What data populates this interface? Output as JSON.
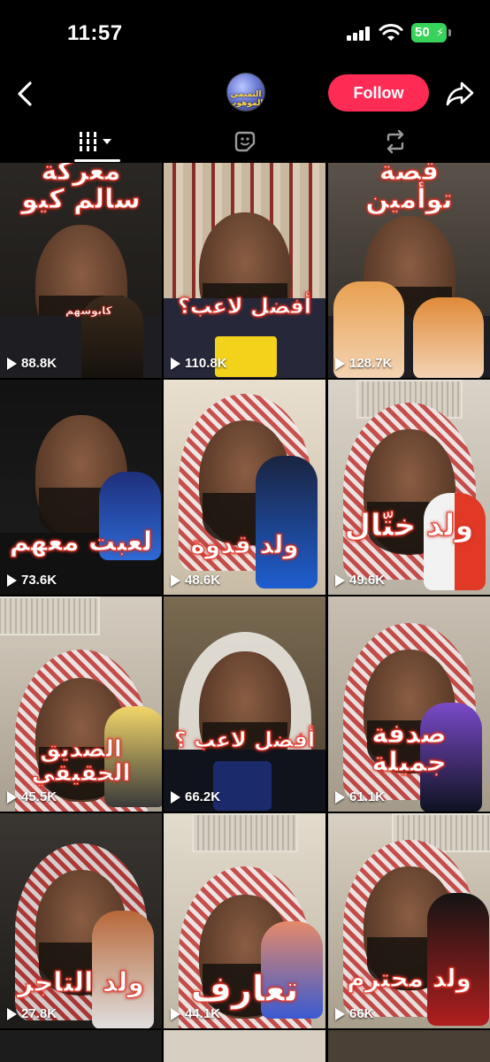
{
  "status_bar": {
    "time": "11:57",
    "battery": "50"
  },
  "header": {
    "avatar_text": "التميمي الموهوب",
    "follow_label": "Follow"
  },
  "grid": {
    "videos": [
      {
        "title": "معركة سالم كيو",
        "sub": "كابوسهم",
        "views": "88.8K"
      },
      {
        "title": "أفضل لاعب؟",
        "views": "110.8K"
      },
      {
        "title": "قصة توأمين",
        "views": "128.7K"
      },
      {
        "title": "لعبت معهم",
        "views": "73.6K"
      },
      {
        "title": "ولد قدوة",
        "views": "48.6K"
      },
      {
        "title": "ولد ختّال",
        "views": "49.6K"
      },
      {
        "title": "الصديق الحقيقي",
        "views": "45.5K"
      },
      {
        "title": "أفضل لاعب ؟",
        "views": "66.2K"
      },
      {
        "title": "صدفة جميلة",
        "views": "61.1K"
      },
      {
        "title": "ولد التاجر",
        "views": "27.8K"
      },
      {
        "title": "تعارف",
        "views": "44.1K"
      },
      {
        "title": "ولد محترم",
        "views": "66K"
      }
    ]
  }
}
